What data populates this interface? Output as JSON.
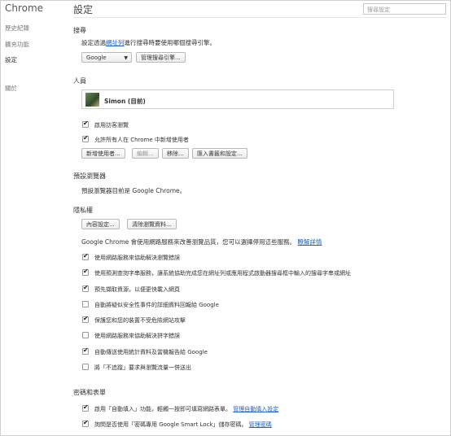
{
  "sidebar": {
    "brand": "Chrome",
    "items": [
      {
        "label": "歷史紀錄"
      },
      {
        "label": "擴充功能"
      },
      {
        "label": "設定"
      },
      {
        "label": "關於"
      }
    ]
  },
  "header": {
    "title": "設定",
    "search_placeholder": "搜尋設定"
  },
  "search_section": {
    "title": "搜尋",
    "desc_prefix": "設定透過",
    "desc_link": "網址列",
    "desc_suffix": "進行搜尋時要使用哪個搜尋引擎。",
    "engine": "Google",
    "manage_button": "管理搜尋引擎..."
  },
  "people_section": {
    "title": "人員",
    "profile_name": "Simon (目前)",
    "options": [
      {
        "label": "啟用訪客瀏覽",
        "checked": true
      },
      {
        "label": "允許所有人在 Chrome 中新增使用者",
        "checked": true
      }
    ],
    "buttons": {
      "add": "新增使用者...",
      "edit": "編輯...",
      "remove": "移除...",
      "import": "匯入書籤和設定..."
    }
  },
  "default_browser": {
    "title": "預設瀏覽器",
    "desc": "預設瀏覽器目前是 Google Chrome。"
  },
  "privacy": {
    "title": "隱私權",
    "content_button": "內容設定...",
    "clear_button": "清除瀏覽資料...",
    "desc": "Google Chrome 會使用網路服務來改善瀏覽品質，您可以選擇停用這些服務。",
    "learn_more": "瞭解詳情",
    "options": [
      {
        "label": "使用網路服務來協助解決瀏覽錯誤",
        "checked": true
      },
      {
        "label": "使用預測查詢字串服務，讓系統協助完成您在網址列或應用程式啟動器搜尋框中輸入的搜尋字串或網址",
        "checked": true
      },
      {
        "label": "預先擷取資源，以便更快載入網頁",
        "checked": true
      },
      {
        "label": "自動將疑似安全性事件的詳細資料回報給 Google",
        "checked": false
      },
      {
        "label": "保護您和您的裝置不受危險網站攻擊",
        "checked": true
      },
      {
        "label": "使用網路服務來協助解決拼字錯誤",
        "checked": false
      },
      {
        "label": "自動傳送使用統計資料及當機報告給 Google",
        "checked": true
      },
      {
        "label": "將「不追蹤」要求與瀏覽流量一併送出",
        "checked": false
      }
    ]
  },
  "passwords": {
    "title": "密碼和表單",
    "autofill_label": "啟用「自動填入」功能，輕觸一按即可填寫網路表單。",
    "autofill_link": "管理自動填入設定",
    "smartlock_label": "詢問是否使用「密碼專用 Google Smart Lock」儲存密碼。",
    "smartlock_link": "管理密碼"
  }
}
